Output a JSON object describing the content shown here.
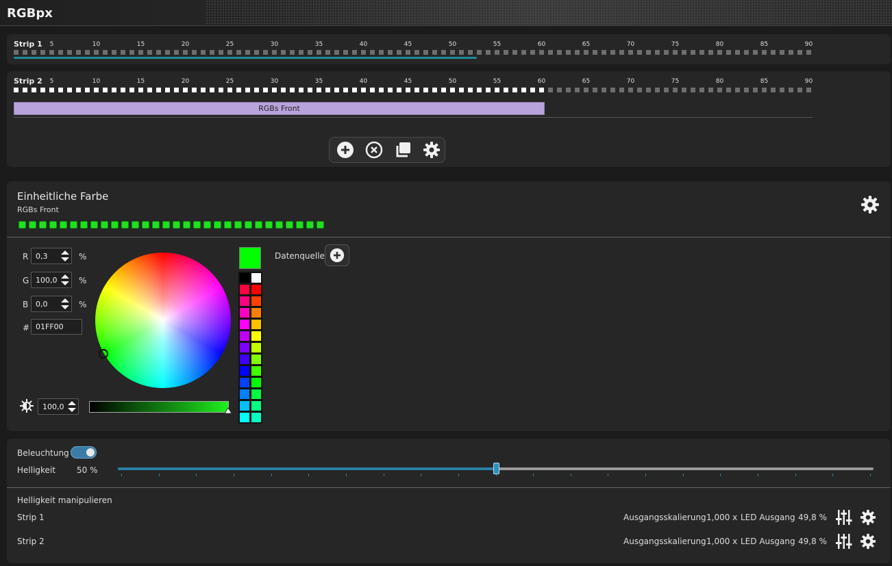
{
  "window": {
    "title": "RGBpx"
  },
  "strips": [
    {
      "label": "Strip 1",
      "led_count": 90,
      "active_count": 0,
      "progress": 0.58
    },
    {
      "label": "Strip 2",
      "led_count": 90,
      "active_count": 60,
      "segment": {
        "label": "RGBs Front",
        "start": 1,
        "end": 60
      }
    }
  ],
  "tick_labels": [
    "5",
    "10",
    "15",
    "20",
    "25",
    "30",
    "35",
    "40",
    "45",
    "50",
    "55",
    "60",
    "65",
    "70",
    "75",
    "80",
    "85",
    "90"
  ],
  "toolbar": {
    "icons": [
      "add-circle-icon",
      "remove-circle-icon",
      "duplicate-icon",
      "gear-icon"
    ]
  },
  "effect": {
    "title": "Einheitliche Farbe",
    "subtitle": "RGBs Front",
    "led_count": 30,
    "led_color": "#20e020"
  },
  "color": {
    "r_label": "R",
    "r_value": "0,3",
    "g_label": "G",
    "g_value": "100,0",
    "b_label": "B",
    "b_value": "0,0",
    "unit": "%",
    "hex_label": "#",
    "hex_value": "01FF00",
    "brightness_value": "100,0",
    "current_swatch": "#01ff00",
    "datasource_label": "Datenquelle"
  },
  "palette": {
    "left": [
      "#000000",
      "#ff0040",
      "#ff0080",
      "#ff00c0",
      "#ff00ff",
      "#c000ff",
      "#8000ff",
      "#4000ff",
      "#0000ff",
      "#0040ff",
      "#0080ff",
      "#00c0ff",
      "#00ffff"
    ],
    "right": [
      "#ffffff",
      "#ff0000",
      "#ff4000",
      "#ff8000",
      "#ffc000",
      "#ffff00",
      "#c0ff00",
      "#80ff00",
      "#40ff00",
      "#00ff00",
      "#00ff40",
      "#00ff80",
      "#00ffc0"
    ]
  },
  "lighting": {
    "toggle_label": "Beleuchtung",
    "toggle_on": true,
    "brightness_label": "Helligkeit",
    "brightness_value": "50 %",
    "brightness_fraction": 0.5
  },
  "manipulate": {
    "title": "Helligkeit manipulieren",
    "rows": [
      {
        "name": "Strip 1",
        "scale_label": "Ausgangsskalierung",
        "scale_value": "1,000 x",
        "out_label": "LED Ausgang",
        "out_value": "49,8 %"
      },
      {
        "name": "Strip 2",
        "scale_label": "Ausgangsskalierung",
        "scale_value": "1,000 x",
        "out_label": "LED Ausgang",
        "out_value": "49,8 %"
      }
    ]
  }
}
